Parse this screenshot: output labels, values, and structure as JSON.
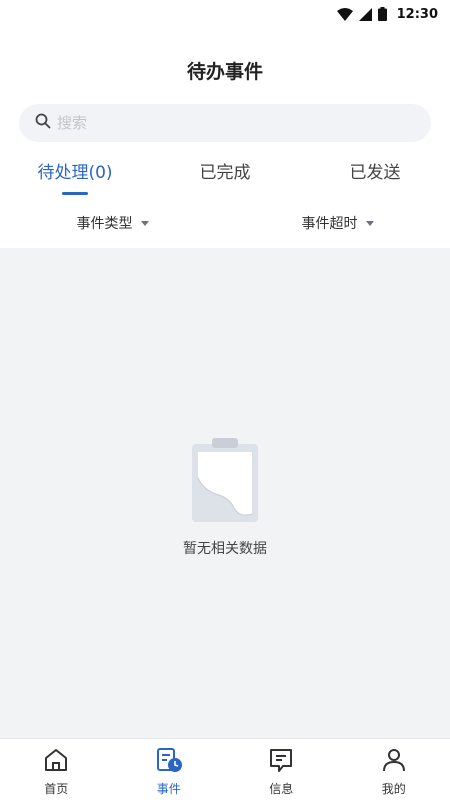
{
  "status_bar": {
    "time": "12:30"
  },
  "header": {
    "title": "待办事件"
  },
  "search": {
    "placeholder": "搜索",
    "value": ""
  },
  "tabs": [
    {
      "label": "待处理(0)",
      "active": true
    },
    {
      "label": "已完成",
      "active": false
    },
    {
      "label": "已发送",
      "active": false
    }
  ],
  "filters": [
    {
      "label": "事件类型"
    },
    {
      "label": "事件超时"
    }
  ],
  "empty_state": {
    "message": "暂无相关数据"
  },
  "bottom_nav": [
    {
      "label": "首页",
      "icon": "home-icon",
      "active": false
    },
    {
      "label": "事件",
      "icon": "event-icon",
      "active": true
    },
    {
      "label": "信息",
      "icon": "message-icon",
      "active": false
    },
    {
      "label": "我的",
      "icon": "profile-icon",
      "active": false
    }
  ],
  "colors": {
    "accent": "#2a66c4",
    "background": "#f2f3f5",
    "text": "#333333"
  }
}
